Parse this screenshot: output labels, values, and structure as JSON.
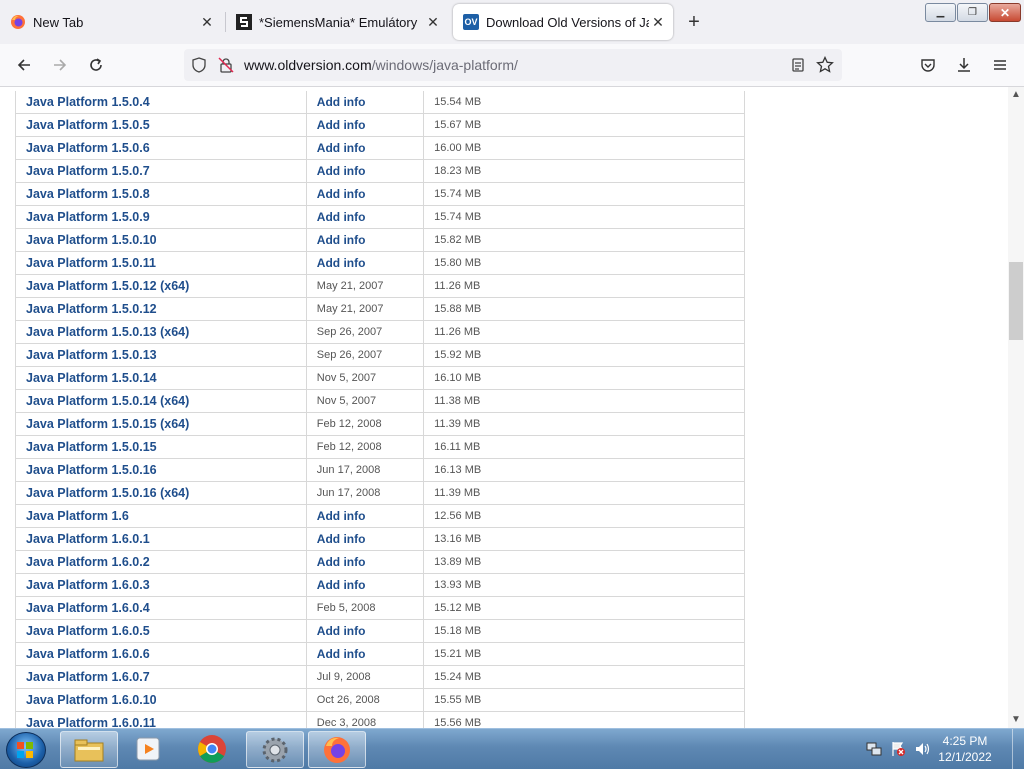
{
  "tabs": [
    {
      "label": "New Tab",
      "icon": "firefox-icon",
      "active": false
    },
    {
      "label": "*SiemensMania* Emulátory",
      "icon": "siemensmania-icon",
      "active": false
    },
    {
      "label": "Download Old Versions of Java P",
      "icon": "oldversion-icon",
      "active": true
    }
  ],
  "oldversion_logo_text": "OV",
  "url": {
    "domain": "www.oldversion.com",
    "path": "/windows/java-platform/"
  },
  "rows": [
    {
      "name": "Java Platform 1.5.0.4",
      "date": "Add info",
      "size": "15.54 MB"
    },
    {
      "name": "Java Platform 1.5.0.5",
      "date": "Add info",
      "size": "15.67 MB"
    },
    {
      "name": "Java Platform 1.5.0.6",
      "date": "Add info",
      "size": "16.00 MB"
    },
    {
      "name": "Java Platform 1.5.0.7",
      "date": "Add info",
      "size": "18.23 MB"
    },
    {
      "name": "Java Platform 1.5.0.8",
      "date": "Add info",
      "size": "15.74 MB"
    },
    {
      "name": "Java Platform 1.5.0.9",
      "date": "Add info",
      "size": "15.74 MB"
    },
    {
      "name": "Java Platform 1.5.0.10",
      "date": "Add info",
      "size": "15.82 MB"
    },
    {
      "name": "Java Platform 1.5.0.11",
      "date": "Add info",
      "size": "15.80 MB"
    },
    {
      "name": "Java Platform 1.5.0.12 (x64)",
      "date": "May 21, 2007",
      "size": "11.26 MB"
    },
    {
      "name": "Java Platform 1.5.0.12",
      "date": "May 21, 2007",
      "size": "15.88 MB"
    },
    {
      "name": "Java Platform 1.5.0.13 (x64)",
      "date": "Sep 26, 2007",
      "size": "11.26 MB"
    },
    {
      "name": "Java Platform 1.5.0.13",
      "date": "Sep 26, 2007",
      "size": "15.92 MB"
    },
    {
      "name": "Java Platform 1.5.0.14",
      "date": "Nov 5, 2007",
      "size": "16.10 MB"
    },
    {
      "name": "Java Platform 1.5.0.14 (x64)",
      "date": "Nov 5, 2007",
      "size": "11.38 MB"
    },
    {
      "name": "Java Platform 1.5.0.15 (x64)",
      "date": "Feb 12, 2008",
      "size": "11.39 MB"
    },
    {
      "name": "Java Platform 1.5.0.15",
      "date": "Feb 12, 2008",
      "size": "16.11 MB"
    },
    {
      "name": "Java Platform 1.5.0.16",
      "date": "Jun 17, 2008",
      "size": "16.13 MB"
    },
    {
      "name": "Java Platform 1.5.0.16 (x64)",
      "date": "Jun 17, 2008",
      "size": "11.39 MB"
    },
    {
      "name": "Java Platform 1.6",
      "date": "Add info",
      "size": "12.56 MB"
    },
    {
      "name": "Java Platform 1.6.0.1",
      "date": "Add info",
      "size": "13.16 MB"
    },
    {
      "name": "Java Platform 1.6.0.2",
      "date": "Add info",
      "size": "13.89 MB"
    },
    {
      "name": "Java Platform 1.6.0.3",
      "date": "Add info",
      "size": "13.93 MB"
    },
    {
      "name": "Java Platform 1.6.0.4",
      "date": "Feb 5, 2008",
      "size": "15.12 MB"
    },
    {
      "name": "Java Platform 1.6.0.5",
      "date": "Add info",
      "size": "15.18 MB"
    },
    {
      "name": "Java Platform 1.6.0.6",
      "date": "Add info",
      "size": "15.21 MB"
    },
    {
      "name": "Java Platform 1.6.0.7",
      "date": "Jul 9, 2008",
      "size": "15.24 MB"
    },
    {
      "name": "Java Platform 1.6.0.10",
      "date": "Oct 26, 2008",
      "size": "15.55 MB"
    },
    {
      "name": "Java Platform 1.6.0.11",
      "date": "Dec 3, 2008",
      "size": "15.56 MB"
    }
  ],
  "taskbar": {
    "apps": [
      "file-explorer-icon",
      "media-player-icon",
      "chrome-icon",
      "settings-gear-icon",
      "firefox-icon"
    ],
    "clock_time": "4:25 PM",
    "clock_date": "12/1/2022"
  },
  "colors": {
    "link": "#1f4e8c",
    "tab_strip": "#f0f0f4",
    "taskbar": "#5e88b3"
  }
}
